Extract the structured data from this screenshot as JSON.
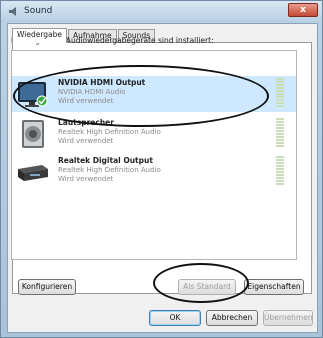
{
  "window": {
    "title": "Sound",
    "close_glyph": "x"
  },
  "tabs": [
    {
      "label": "Wiedergabe",
      "active": true
    },
    {
      "label": "Aufnahme",
      "active": false
    },
    {
      "label": "Sounds",
      "active": false
    }
  ],
  "instruction": "Die folgenden Audiowiedergabegeräte sind installiert:",
  "devices": [
    {
      "name": "NVIDIA HDMI Output",
      "driver": "NVIDIA HDMI Audio",
      "status": "Wird verwendet",
      "icon": "monitor-icon",
      "selected": true,
      "default_check": true
    },
    {
      "name": "Lautsprecher",
      "driver": "Realtek High Definition Audio",
      "status": "Wird verwendet",
      "icon": "speaker-icon",
      "selected": false,
      "default_check": false
    },
    {
      "name": "Realtek Digital Output",
      "driver": "Realtek High Definition Audio",
      "status": "Wird verwendet",
      "icon": "digital-receiver-icon",
      "selected": false,
      "default_check": false
    }
  ],
  "buttons": {
    "configure": "Konfigurieren",
    "set_default": "Als Standard",
    "properties": "Eigenschaften",
    "ok": "OK",
    "cancel": "Abbrechen",
    "apply": "Übernehmen"
  },
  "colors": {
    "selection": "#cde8ff",
    "annotation": "#111111",
    "check_badge": "#3aa843"
  }
}
